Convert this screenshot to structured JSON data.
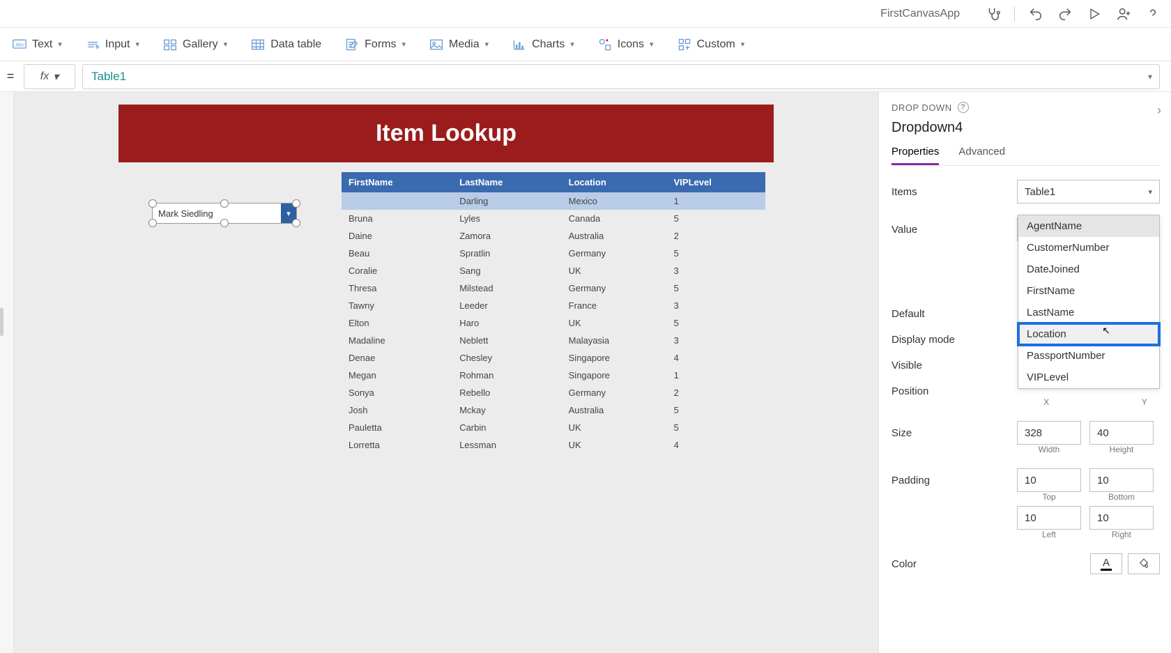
{
  "app_name": "FirstCanvasApp",
  "ribbon": {
    "text": "Text",
    "input": "Input",
    "gallery": "Gallery",
    "datatable": "Data table",
    "forms": "Forms",
    "media": "Media",
    "charts": "Charts",
    "icons": "Icons",
    "custom": "Custom"
  },
  "formula": {
    "eq": "=",
    "fx": "fx",
    "value": "Table1"
  },
  "canvas": {
    "title": "Item Lookup",
    "dropdown_value": "Mark Siedling",
    "table": {
      "headers": [
        "FirstName",
        "LastName",
        "Location",
        "VIPLevel"
      ],
      "rows": [
        [
          "",
          "Darling",
          "Mexico",
          "1"
        ],
        [
          "Bruna",
          "Lyles",
          "Canada",
          "5"
        ],
        [
          "Daine",
          "Zamora",
          "Australia",
          "2"
        ],
        [
          "Beau",
          "Spratlin",
          "Germany",
          "5"
        ],
        [
          "Coralie",
          "Sang",
          "UK",
          "3"
        ],
        [
          "Thresa",
          "Milstead",
          "Germany",
          "5"
        ],
        [
          "Tawny",
          "Leeder",
          "France",
          "3"
        ],
        [
          "Elton",
          "Haro",
          "UK",
          "5"
        ],
        [
          "Madaline",
          "Neblett",
          "Malayasia",
          "3"
        ],
        [
          "Denae",
          "Chesley",
          "Singapore",
          "4"
        ],
        [
          "Megan",
          "Rohman",
          "Singapore",
          "1"
        ],
        [
          "Sonya",
          "Rebello",
          "Germany",
          "2"
        ],
        [
          "Josh",
          "Mckay",
          "Australia",
          "5"
        ],
        [
          "Pauletta",
          "Carbin",
          "UK",
          "5"
        ],
        [
          "Lorretta",
          "Lessman",
          "UK",
          "4"
        ]
      ]
    }
  },
  "props": {
    "type_label": "DROP DOWN",
    "control_name": "Dropdown4",
    "tabs": {
      "properties": "Properties",
      "advanced": "Advanced"
    },
    "items": {
      "label": "Items",
      "value": "Table1"
    },
    "value": {
      "label": "Value",
      "value": "AgentName"
    },
    "value_options": [
      "AgentName",
      "CustomerNumber",
      "DateJoined",
      "FirstName",
      "LastName",
      "Location",
      "PassportNumber",
      "VIPLevel"
    ],
    "highlighted_option": "Location",
    "default": "Default",
    "display_mode": "Display mode",
    "visible": "Visible",
    "position": {
      "label": "Position",
      "x_label": "X",
      "y_label": "Y"
    },
    "size": {
      "label": "Size",
      "width": "328",
      "height": "40",
      "w_label": "Width",
      "h_label": "Height"
    },
    "padding": {
      "label": "Padding",
      "top": "10",
      "bottom": "10",
      "left": "10",
      "right": "10",
      "t_label": "Top",
      "b_label": "Bottom",
      "l_label": "Left",
      "r_label": "Right"
    },
    "color": {
      "label": "Color",
      "glyph": "A"
    }
  }
}
